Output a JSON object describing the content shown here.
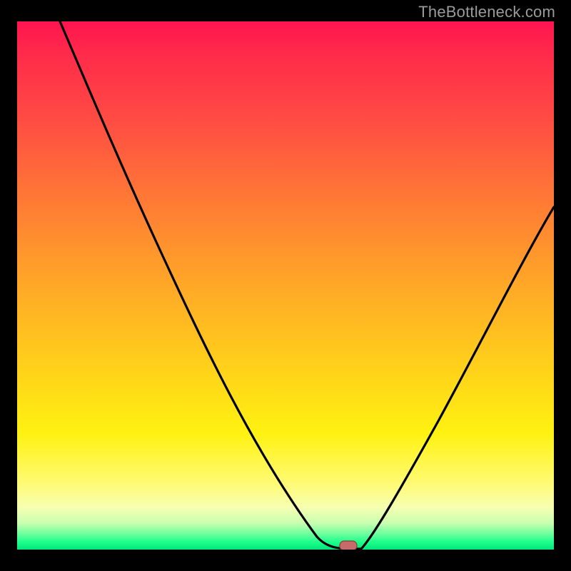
{
  "watermark": "TheBottleneck.com",
  "colors": {
    "background": "#000000",
    "curve": "#000000",
    "marker_fill": "#c76a6a",
    "marker_stroke": "#8e3b3b",
    "gradient_stops": [
      "#ff1450",
      "#ff4a44",
      "#ffa827",
      "#ffd21a",
      "#fffb7a",
      "#6fff9f",
      "#00e67a"
    ]
  },
  "chart_data": {
    "type": "line",
    "title": "",
    "xlabel": "",
    "ylabel": "",
    "xlim": [
      0,
      100
    ],
    "ylim": [
      0,
      100
    ],
    "notes": "V-shaped bottleneck curve on a red-to-green heat gradient. Minimum (0%) at x≈61; left arm rises to 100% at x=0; right arm rises to ~60% at x=100. Small rounded marker at the minimum.",
    "marker": {
      "x": 61,
      "y": 0,
      "shape": "rounded-rect"
    },
    "series": [
      {
        "name": "bottleneck",
        "x": [
          0,
          5,
          10,
          15,
          20,
          25,
          30,
          35,
          40,
          45,
          50,
          55,
          58,
          61,
          64,
          68,
          72,
          76,
          80,
          84,
          88,
          92,
          96,
          100
        ],
        "y": [
          100,
          94,
          88,
          82,
          75,
          68,
          60,
          52,
          44,
          35,
          26,
          15,
          6,
          0,
          3,
          10,
          18,
          26,
          33,
          40,
          46,
          51,
          56,
          60
        ]
      }
    ]
  }
}
